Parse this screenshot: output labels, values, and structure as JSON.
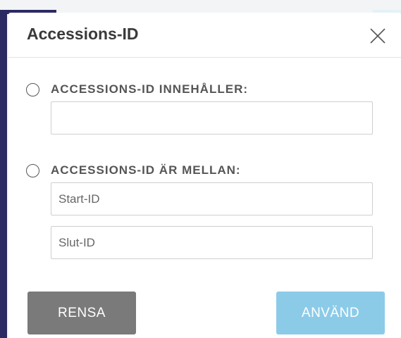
{
  "dialog": {
    "title": "Accessions-ID",
    "close_icon": "close-icon"
  },
  "options": {
    "contains": {
      "label": "ACCESSIONS-ID INNEHÅLLER:",
      "selected": false,
      "input_value": "",
      "input_placeholder": ""
    },
    "between": {
      "label": "ACCESSIONS-ID ÄR MELLAN:",
      "selected": false,
      "start_placeholder": "Start-ID",
      "end_placeholder": "Slut-ID"
    }
  },
  "buttons": {
    "clear_label": "RENSA",
    "apply_label": "ANVÄND"
  },
  "colors": {
    "clear_button": "#7a7a7a",
    "apply_button": "#8ccbe8",
    "accent": "#2c2a63"
  }
}
